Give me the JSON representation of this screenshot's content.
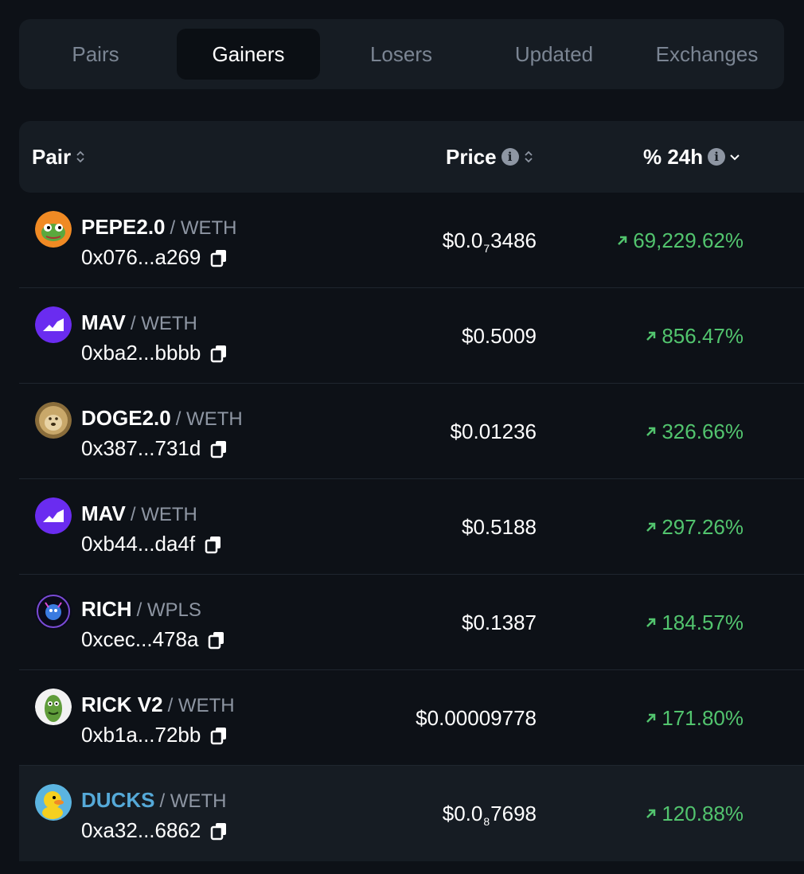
{
  "tabs": [
    {
      "label": "Pairs",
      "active": false
    },
    {
      "label": "Gainers",
      "active": true
    },
    {
      "label": "Losers",
      "active": false
    },
    {
      "label": "Updated",
      "active": false
    },
    {
      "label": "Exchanges",
      "active": false
    }
  ],
  "table": {
    "headers": {
      "pair": "Pair",
      "price": "Price",
      "change": "% 24h"
    },
    "rows": [
      {
        "symbol": "PEPE2.0",
        "quote": "/ WETH",
        "address": "0x076...a269",
        "price_prefix": "$0.0",
        "price_sub": "7",
        "price_rest": "3486",
        "change": "69,229.62%",
        "avatar": "pepe-icon"
      },
      {
        "symbol": "MAV",
        "quote": "/ WETH",
        "address": "0xba2...bbbb",
        "price_prefix": "$0.5009",
        "price_sub": "",
        "price_rest": "",
        "change": "856.47%",
        "avatar": "mav-icon"
      },
      {
        "symbol": "DOGE2.0",
        "quote": "/ WETH",
        "address": "0x387...731d",
        "price_prefix": "$0.01236",
        "price_sub": "",
        "price_rest": "",
        "change": "326.66%",
        "avatar": "doge-icon"
      },
      {
        "symbol": "MAV",
        "quote": "/ WETH",
        "address": "0xb44...da4f",
        "price_prefix": "$0.5188",
        "price_sub": "",
        "price_rest": "",
        "change": "297.26%",
        "avatar": "mav-icon"
      },
      {
        "symbol": "RICH",
        "quote": "/ WPLS",
        "address": "0xcec...478a",
        "price_prefix": "$0.1387",
        "price_sub": "",
        "price_rest": "",
        "change": "184.57%",
        "avatar": "rich-icon"
      },
      {
        "symbol": "RICK V2",
        "quote": "/ WETH",
        "address": "0xb1a...72bb",
        "price_prefix": "$0.00009778",
        "price_sub": "",
        "price_rest": "",
        "change": "171.80%",
        "avatar": "pickle-icon"
      },
      {
        "symbol": "DUCKS",
        "quote": "/ WETH",
        "address": "0xa32...6862",
        "price_prefix": "$0.0",
        "price_sub": "8",
        "price_rest": "7698",
        "change": "120.88%",
        "avatar": "duck-icon"
      }
    ]
  },
  "colors": {
    "background": "#0d1117",
    "panel": "#161c23",
    "positive": "#52c46e",
    "link": "#55a9d8",
    "muted": "#8e96a3"
  }
}
